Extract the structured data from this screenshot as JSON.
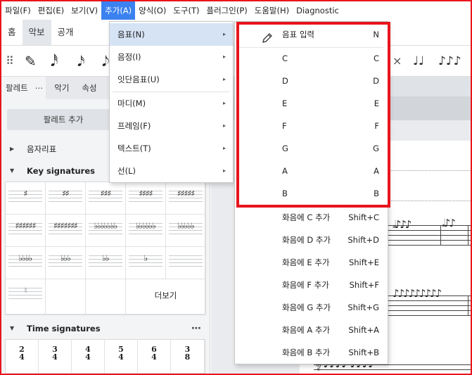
{
  "menubar": {
    "items": [
      "파일(F)",
      "편집(E)",
      "보기(V)",
      "추가(A)",
      "양식(O)",
      "도구(T)",
      "플러그인(P)",
      "도움말(H)",
      "Diagnostic"
    ],
    "active_index": 3
  },
  "ribbon": {
    "tabs": [
      "홈",
      "악보",
      "공개"
    ],
    "active_index": 1
  },
  "toolbar": {
    "pencil": "✎",
    "note_glyphs": [
      "𝅘𝅥𝅰",
      "𝅘𝅥𝅯",
      "𝅘𝅥𝅮"
    ],
    "tie_glyphs": [
      "♩♩",
      "♪♪♪"
    ],
    "close": "×",
    "grip": "⠿"
  },
  "panel": {
    "tabs": [
      "팔레트",
      "⋯",
      "악기",
      "속성"
    ],
    "add_palette": "팔레트 추가",
    "section_accidentals": "음자리표",
    "section_key": "Key signatures",
    "key_cells": [
      "♯",
      "♯♯",
      "♯♯♯",
      "♯♯♯♯",
      "♯♯♯♯♯",
      "♯♯♯♯♯♯",
      "♯♯♯♯♯♯♯",
      "♭♭♭♭♭♭♭",
      "♭♭♭♭♭♭",
      "♭♭♭♭♭",
      "♭♭♭♭",
      "♭♭♭",
      "♭♭",
      "♭",
      "♮"
    ],
    "more_label": "더보기",
    "section_time": "Time signatures",
    "time_cells": [
      [
        "2",
        "4"
      ],
      [
        "3",
        "4"
      ],
      [
        "4",
        "4"
      ],
      [
        "5",
        "4"
      ],
      [
        "6",
        "4"
      ],
      [
        "3",
        "8"
      ]
    ],
    "dots": "⋯"
  },
  "menu_add": {
    "items": [
      {
        "label": "음표(N)",
        "highlighted": true
      },
      {
        "label": "음정(I)"
      },
      {
        "label": "잇단음표(U)"
      },
      {
        "label": "마디(M)"
      },
      {
        "label": "프레임(F)"
      },
      {
        "label": "텍스트(T)"
      },
      {
        "label": "선(L)"
      }
    ],
    "chevron": "▸"
  },
  "menu_notes": {
    "items": [
      {
        "label": "음표 입력",
        "shortcut": "N"
      },
      {
        "label": "C",
        "shortcut": "C"
      },
      {
        "label": "D",
        "shortcut": "D"
      },
      {
        "label": "E",
        "shortcut": "E"
      },
      {
        "label": "F",
        "shortcut": "F"
      },
      {
        "label": "G",
        "shortcut": "G"
      },
      {
        "label": "A",
        "shortcut": "A"
      },
      {
        "label": "B",
        "shortcut": "B"
      },
      {
        "label": "화음에 C 추가",
        "shortcut": "Shift+C"
      },
      {
        "label": "화음에 D 추가",
        "shortcut": "Shift+D"
      },
      {
        "label": "화음에 E 추가",
        "shortcut": "Shift+E"
      },
      {
        "label": "화음에 F 추가",
        "shortcut": "Shift+F"
      },
      {
        "label": "화음에 G 추가",
        "shortcut": "Shift+G"
      },
      {
        "label": "화음에 A 추가",
        "shortcut": "Shift+A"
      },
      {
        "label": "화음에 B 추가",
        "shortcut": "Shift+B"
      }
    ]
  },
  "colors": {
    "accent": "#3b82f0",
    "highlight_box": "#e8141c",
    "menu_hover": "#d5e3f5"
  }
}
